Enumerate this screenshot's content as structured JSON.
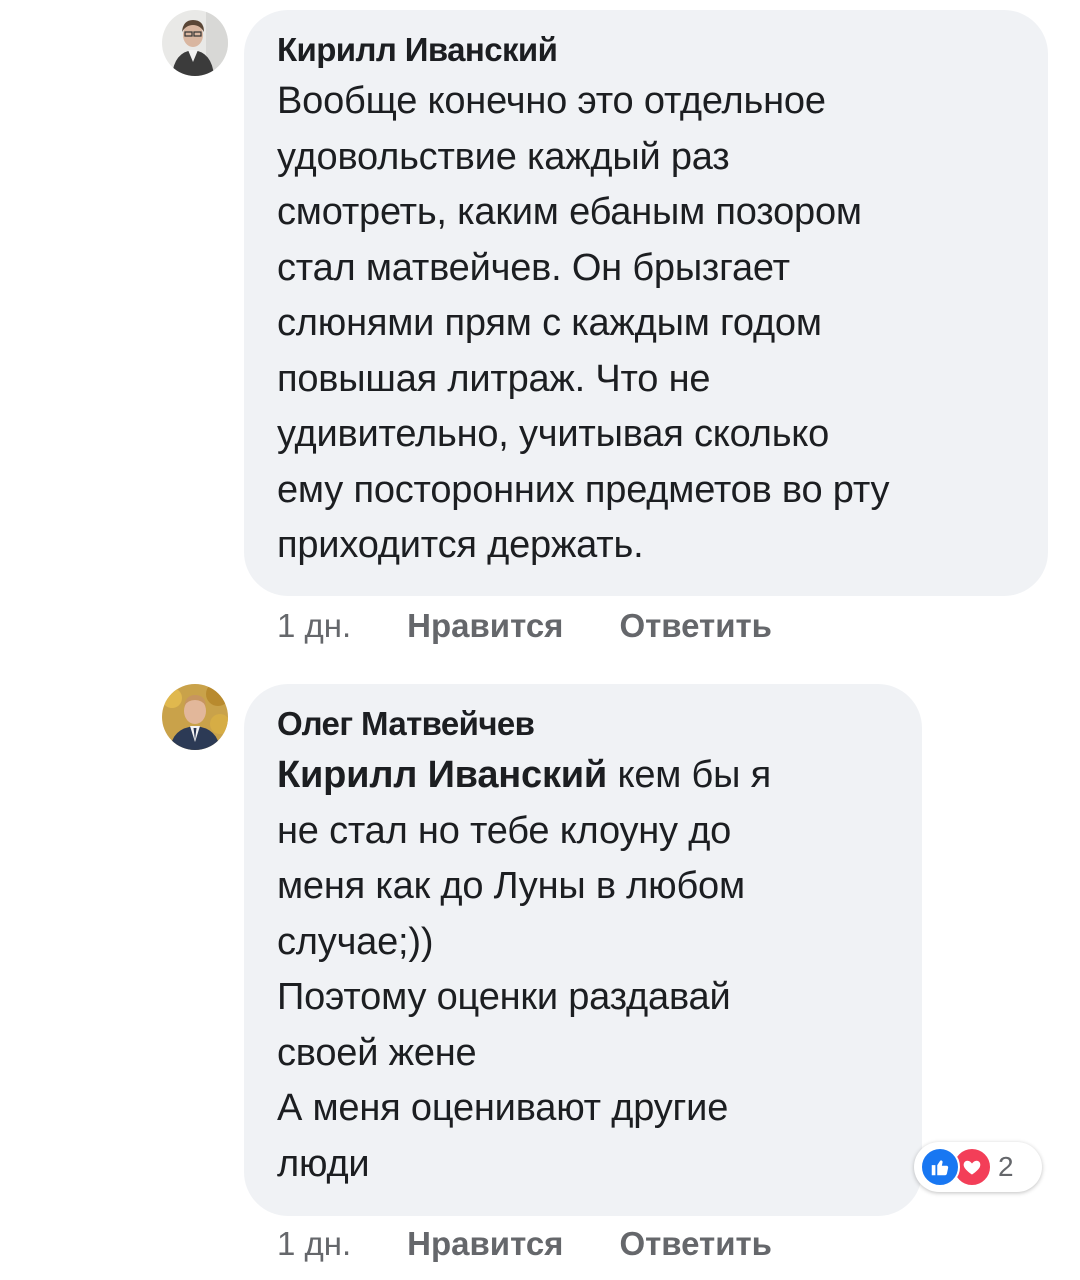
{
  "comments": [
    {
      "author": "Кирилл Иванский",
      "avatar_icon": "avatar-photo-icon",
      "text": "Вообще конечно это отдельное\nудовольствие каждый раз\nсмотреть, каким ебаным позором\nстал матвейчев. Он брызгает\nслюнями прям с каждым годом\nповышая литраж. Что не\nудивительно, учитывая сколько\nему посторонних предметов во рту\nприходится держать.",
      "time": "1 дн.",
      "like_label": "Нравится",
      "reply_label": "Ответить"
    },
    {
      "author": "Олег Матвейчев",
      "avatar_icon": "avatar-photo-icon",
      "mention": "Кирилл Иванский",
      "text": " кем бы я\nне стал но тебе клоуну до\nменя как до Луны в любом\nслучае;))\nПоэтому оценки раздавай\nсвоей жене\nА меня оценивают другие\nлюди",
      "time": "1 дн.",
      "like_label": "Нравится",
      "reply_label": "Ответить",
      "reactions": {
        "icons": [
          "like-reaction-icon",
          "love-reaction-icon"
        ],
        "count": "2"
      }
    }
  ],
  "colors": {
    "bubble": "#f0f2f5",
    "meta_text": "#65676b",
    "like_reaction": "#1877f2",
    "love_reaction": "#f33e58"
  }
}
